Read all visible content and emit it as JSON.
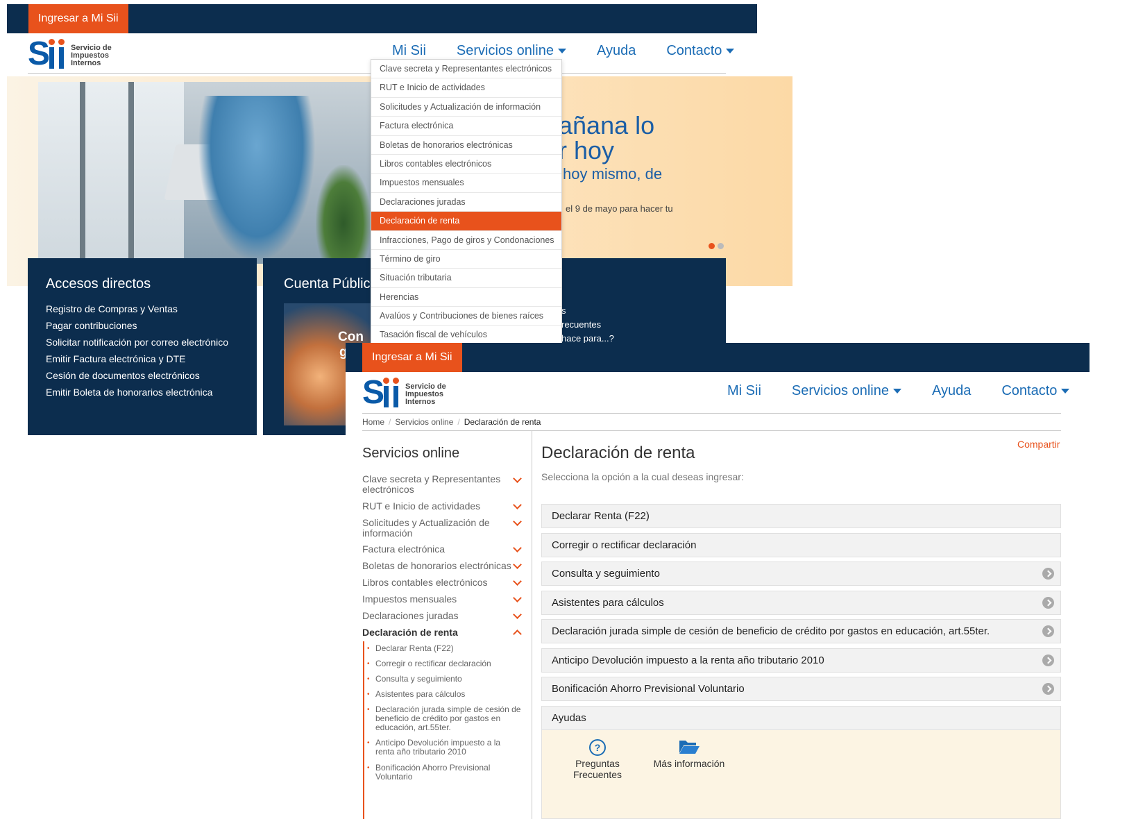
{
  "screen1": {
    "header": {
      "login_label": "Ingresar a Mi Sii"
    },
    "logo": {
      "line1": "Servicio de",
      "line2": "Impuestos",
      "line3": "Internos"
    },
    "nav": {
      "mi_sii": "Mi Sii",
      "servicios": "Servicios online",
      "ayuda": "Ayuda",
      "contacto": "Contacto"
    },
    "hero": {
      "line1": "añana lo",
      "line2": "r hoy",
      "line3": "hoy mismo, de",
      "line4": "el 9 de mayo para hacer tu"
    },
    "accesos": {
      "title": "Accesos directos",
      "items": [
        "Registro de Compras y Ventas",
        "Pagar contribuciones",
        "Solicitar notificación por correo electrónico",
        "Emitir Factura electrónica y DTE",
        "Cesión de documentos electrónicos",
        "Emitir Boleta de honorarios electrónica"
      ]
    },
    "cuenta": {
      "title": "Cuenta Pública",
      "crowd_text1": "Con",
      "crowd_text2": "g"
    },
    "right_panel": {
      "line1": "s",
      "line2": "recuentes",
      "line3": "hace para...?"
    },
    "dropdown": {
      "items": [
        "Clave secreta y Representantes electrónicos",
        "RUT e Inicio de actividades",
        "Solicitudes y Actualización de información",
        "Factura electrónica",
        "Boletas de honorarios electrónicas",
        "Libros contables electrónicos",
        "Impuestos mensuales",
        "Declaraciones juradas",
        "Declaración de renta",
        "Infracciones, Pago de giros y Condonaciones",
        "Término de giro",
        "Situación tributaria",
        "Herencias",
        "Avalúos y Contribuciones de bienes raíces",
        "Tasación fiscal de vehículos"
      ],
      "selected": "Declaración de renta"
    }
  },
  "screen2": {
    "header": {
      "login_label": "Ingresar a Mi Sii"
    },
    "logo": {
      "line1": "Servicio de",
      "line2": "Impuestos",
      "line3": "Internos"
    },
    "nav": {
      "mi_sii": "Mi Sii",
      "servicios": "Servicios online",
      "ayuda": "Ayuda",
      "contacto": "Contacto"
    },
    "breadcrumb": {
      "home": "Home",
      "section": "Servicios online",
      "current": "Declaración de renta",
      "separator": "/"
    },
    "sidebar": {
      "title": "Servicios online",
      "items": [
        "Clave secreta y Representantes electrónicos",
        "RUT e Inicio de actividades",
        "Solicitudes y Actualización de información",
        "Factura electrónica",
        "Boletas de honorarios electrónicas",
        "Libros contables electrónicos",
        "Impuestos mensuales",
        "Declaraciones juradas",
        "Declaración de renta"
      ],
      "subitems": [
        "Declarar Renta (F22)",
        "Corregir o rectificar declaración",
        "Consulta y seguimiento",
        "Asistentes para cálculos",
        "Declaración jurada simple de cesión de beneficio de crédito por gastos en educación, art.55ter.",
        "Anticipo Devolución impuesto a la renta año tributario 2010",
        "Bonificación Ahorro Previsional Voluntario"
      ]
    },
    "main": {
      "title": "Declaración de renta",
      "subtitle": "Selecciona la opción a la cual deseas ingresar:",
      "share": "Compartir",
      "options": [
        "Declarar Renta (F22)",
        "Corregir o rectificar declaración",
        "Consulta y seguimiento",
        "Asistentes para cálculos",
        "Declaración jurada simple de cesión de beneficio de crédito por gastos en educación, art.55ter.",
        "Anticipo Devolución impuesto a la renta año tributario 2010",
        "Bonificación Ahorro Previsional Voluntario"
      ],
      "ayudas": {
        "title": "Ayudas",
        "faq_line1": "Preguntas",
        "faq_line2": "Frecuentes",
        "more": "Más información"
      }
    }
  },
  "colors": {
    "navy": "#0c2d4e",
    "orange": "#e8521c",
    "link_blue": "#1b6cb5"
  }
}
